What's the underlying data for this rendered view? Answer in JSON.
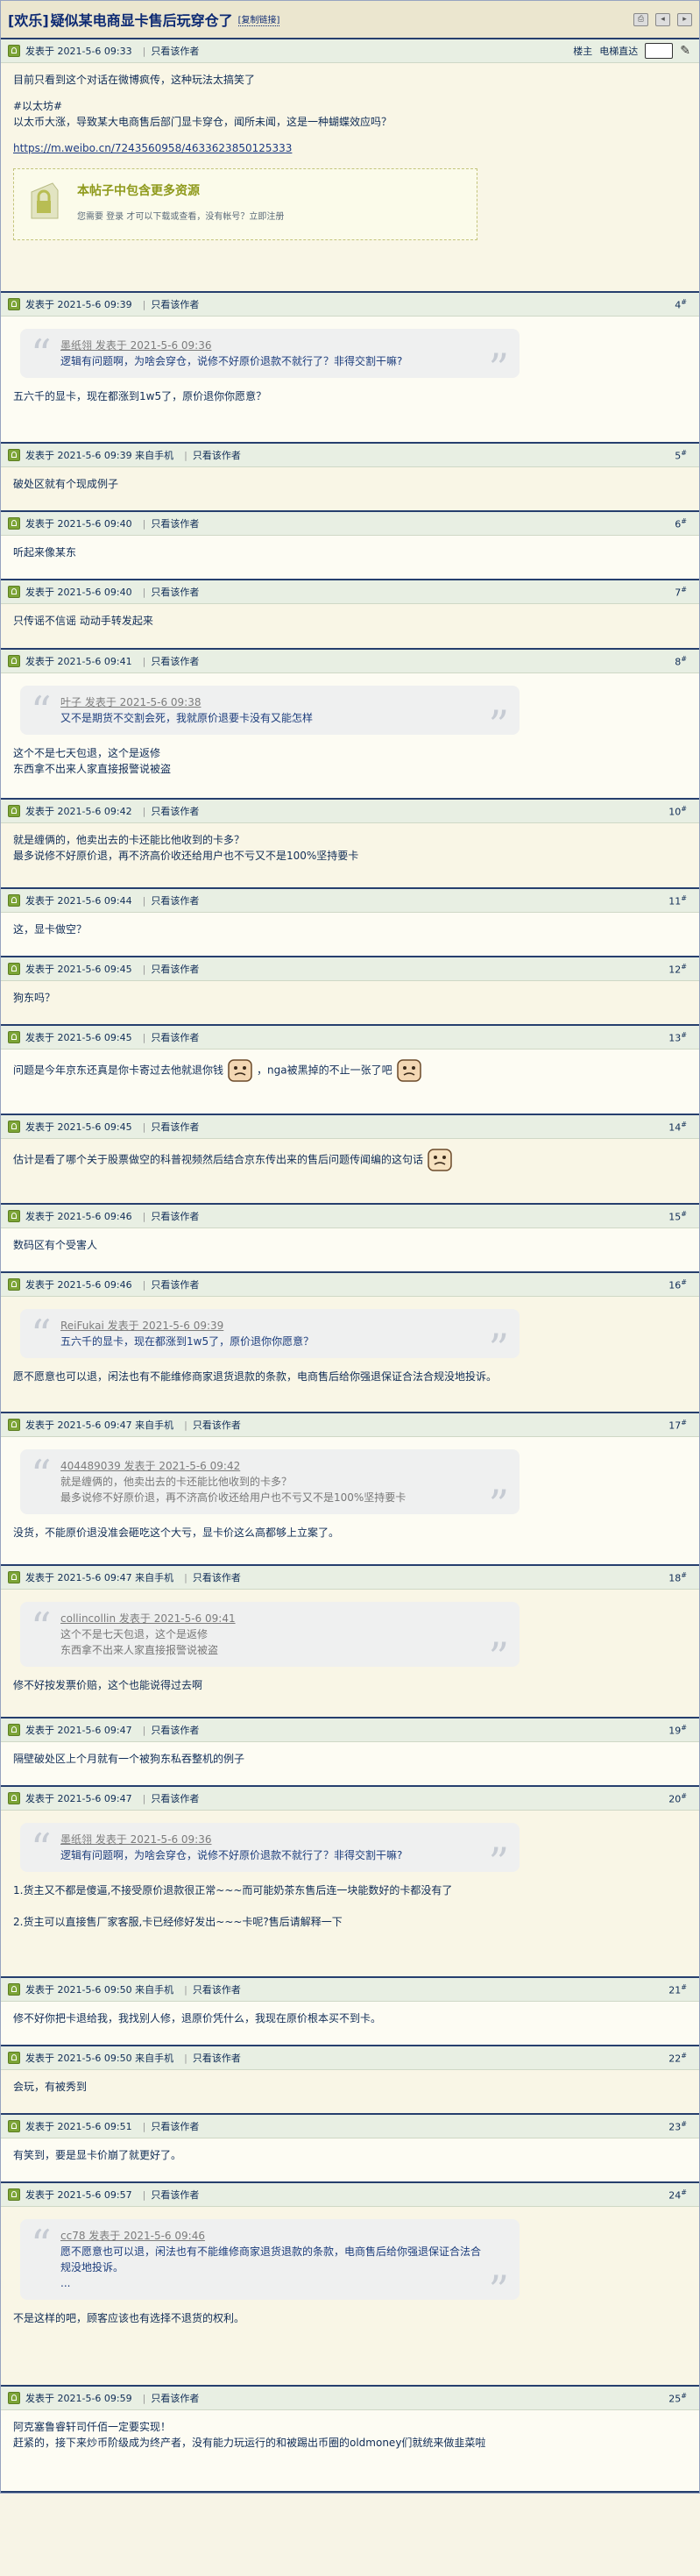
{
  "topic": {
    "tag": "[欢乐]",
    "title": "疑似某电商显卡售后玩穿仓了",
    "copy_link": "[复制链接]"
  },
  "op": {
    "date": "发表于 2021-5-6 09:33",
    "only_author": "只看该作者",
    "sort_label": "楼主",
    "mode_label": "电梯直达",
    "line1": "目前只看到这个对话在微博疯传，这种玩法太搞笑了",
    "line2": "#以太坊#",
    "line3": "以太币大涨，导致某大电商售后部门显卡穿仓，闻所未闻，这是一种蝴蝶效应吗？",
    "url": "https://m.weibo.cn/7243560958/4633623850125333",
    "restrict_title": "本帖子中包含更多资源",
    "restrict_sub": "您需要 登录 才可以下载或查看，没有帐号？立即注册"
  },
  "posts": [
    {
      "date": "发表于 2021-5-6 09:39",
      "only": "只看该作者",
      "floor": "4",
      "quote_user": "墨纸翎 发表于 2021-5-6 09:36",
      "quote": [
        "逻辑有问题啊，为啥会穿仓，说修不好原价退款不就行了？非得交割干嘛?"
      ],
      "lines": [
        "五六千的显卡，现在都涨到1w5了，原价退你你愿意？"
      ]
    },
    {
      "date": "发表于 2021-5-6 09:39 来自手机",
      "only": "只看该作者",
      "floor": "5",
      "lines": [
        "破处区就有个现成例子"
      ]
    },
    {
      "date": "发表于 2021-5-6 09:40",
      "only": "只看该作者",
      "floor": "6",
      "lines": [
        "听起来像某东"
      ]
    },
    {
      "date": "发表于 2021-5-6 09:40",
      "only": "只看该作者",
      "floor": "7",
      "lines": [
        "只传谣不信谣 动动手转发起来"
      ]
    },
    {
      "date": "发表于 2021-5-6 09:41",
      "only": "只看该作者",
      "floor": "8",
      "quote_user": "叶子 发表于 2021-5-6 09:38",
      "quote": [
        "又不是期货不交割会死，我就原价退要卡没有又能怎样"
      ],
      "lines": [
        "这个不是七天包退，这个是返修",
        "东西拿不出来人家直接报警说被盗"
      ]
    },
    {
      "date": "发表于 2021-5-6 09:42",
      "only": "只看该作者",
      "floor": "10",
      "lines": [
        "就是缠俩的，他卖出去的卡还能比他收到的卡多？",
        "最多说修不好原价退，再不济高价收还给用户也不亏又不是100%坚持要卡"
      ]
    },
    {
      "date": "发表于 2021-5-6 09:44",
      "only": "只看该作者",
      "floor": "11",
      "lines": [
        "这，显卡做空？"
      ]
    },
    {
      "date": "发表于 2021-5-6 09:45",
      "only": "只看该作者",
      "floor": "12",
      "lines": [
        "狗东吗？"
      ]
    },
    {
      "date": "发表于 2021-5-6 09:45",
      "only": "只看该作者",
      "floor": "13",
      "face_a": "问题是今年京东还真是你卡寄过去他就退你钱",
      "face_b": "，nga被黑掉的不止一张了吧"
    },
    {
      "date": "发表于 2021-5-6 09:45",
      "only": "只看该作者",
      "floor": "14",
      "face_c": "估计是看了哪个关于股票做空的科普视频然后结合京东传出来的售后问题传闻编的这句话"
    },
    {
      "date": "发表于 2021-5-6 09:46",
      "only": "只看该作者",
      "floor": "15",
      "lines": [
        "数码区有个受害人"
      ]
    },
    {
      "date": "发表于 2021-5-6 09:46",
      "only": "只看该作者",
      "floor": "16",
      "quote_user": "ReiFukai 发表于 2021-5-6 09:39",
      "quote": [
        "五六千的显卡，现在都涨到1w5了，原价退你你愿意？"
      ],
      "lines": [
        "愿不愿意也可以退，闲法也有不能维修商家退货退款的条款，电商售后给你强退保证合法合规没地投诉。"
      ]
    },
    {
      "date": "发表于 2021-5-6 09:47 来自手机",
      "only": "只看该作者",
      "floor": "17",
      "quote_user": "404489039 发表于 2021-5-6 09:42",
      "quote_grey": true,
      "quote": [
        "就是缠俩的，他卖出去的卡还能比他收到的卡多？",
        "最多说修不好原价退，再不济高价收还给用户也不亏又不是100%坚持要卡"
      ],
      "lines": [
        "没货，不能原价退没准会砸吃这个大亏，显卡价这么高都够上立案了。"
      ]
    },
    {
      "date": "发表于 2021-5-6 09:47 来自手机",
      "only": "只看该作者",
      "floor": "18",
      "quote_user": "collincollin 发表于 2021-5-6 09:41",
      "quote_grey": true,
      "quote": [
        "这个不是七天包退，这个是返修",
        "东西拿不出来人家直接报警说被盗"
      ],
      "lines": [
        "修不好按发票价赔，这个也能说得过去啊"
      ]
    },
    {
      "date": "发表于 2021-5-6 09:47",
      "only": "只看该作者",
      "floor": "19",
      "lines": [
        "隔壁破处区上个月就有一个被狗东私吞整机的例子"
      ]
    },
    {
      "date": "发表于 2021-5-6 09:47",
      "only": "只看该作者",
      "floor": "20",
      "quote_user": "墨纸翎 发表于 2021-5-6 09:36",
      "quote": [
        "逻辑有问题啊，为啥会穿仓，说修不好原价退款不就行了？非得交割干嘛?"
      ],
      "lines": [
        "1.货主又不都是傻逼,不接受原价退款很正常~~~而可能奶茶东售后连一块能数好的卡都没有了",
        "",
        "2.货主可以直接售厂家客服,卡已经修好发出~~~卡呢?售后请解释一下"
      ]
    },
    {
      "date": "发表于 2021-5-6 09:50 来自手机",
      "only": "只看该作者",
      "floor": "21",
      "lines": [
        "修不好你把卡退给我，我找别人修，退原价凭什么，我现在原价根本买不到卡。"
      ]
    },
    {
      "date": "发表于 2021-5-6 09:50 来自手机",
      "only": "只看该作者",
      "floor": "22",
      "lines": [
        "会玩，有被秀到"
      ]
    },
    {
      "date": "发表于 2021-5-6 09:51",
      "only": "只看该作者",
      "floor": "23",
      "lines": [
        "有笑到，要是显卡价崩了就更好了。"
      ]
    },
    {
      "date": "发表于 2021-5-6 09:57",
      "only": "只看该作者",
      "floor": "24",
      "quote_user": "cc78 发表于 2021-5-6 09:46",
      "quote": [
        "愿不愿意也可以退，闲法也有不能维修商家退货退款的条款，电商售后给你强退保证合法合规没地投诉。",
        "..."
      ],
      "lines": [
        "不是这样的吧，顾客应该也有选择不退货的权利。"
      ]
    },
    {
      "date": "发表于 2021-5-6 09:59",
      "only": "只看该作者",
      "floor": "25",
      "lines": [
        "阿克塞鲁睿轩司仟佰一定要实现！",
        "赶紧的，接下来炒币阶级成为终产者，没有能力玩运行的和被踢出币圈的oldmoney们就统来做韭菜啦"
      ]
    }
  ]
}
